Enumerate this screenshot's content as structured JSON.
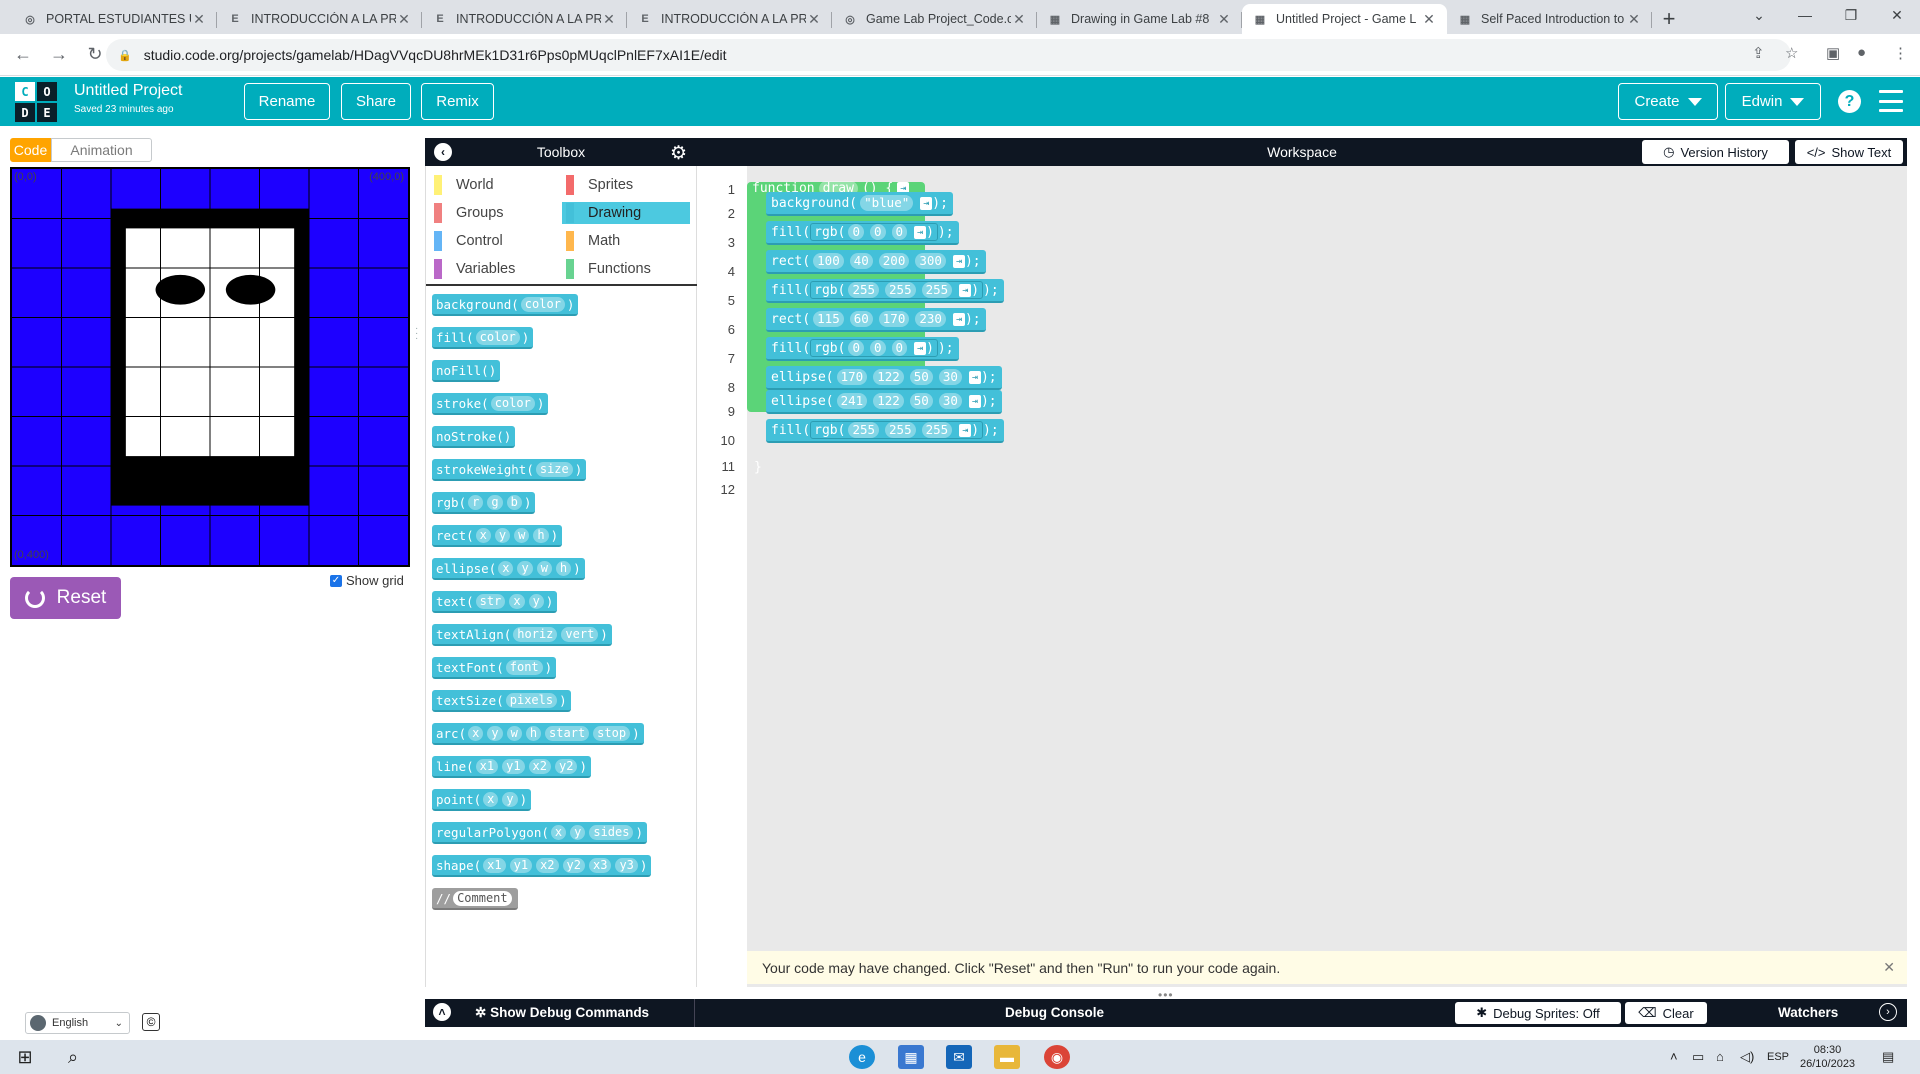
{
  "browser": {
    "tabs": [
      {
        "title": "PORTAL ESTUDIANTES U",
        "icon": "globe-icon"
      },
      {
        "title": "INTRODUCCIÓN A LA PR",
        "icon": "edu-icon"
      },
      {
        "title": "INTRODUCCIÓN A LA PR",
        "icon": "edu-icon"
      },
      {
        "title": "INTRODUCCIÓN A LA PR",
        "icon": "edu-icon"
      },
      {
        "title": "Game Lab Project_Code.o",
        "icon": "globe-icon"
      },
      {
        "title": "Drawing in Game Lab #8",
        "icon": "codeorg-icon"
      },
      {
        "title": "Untitled Project - Game L",
        "icon": "codeorg-icon",
        "active": true
      },
      {
        "title": "Self Paced Introduction to",
        "icon": "codeorg-icon"
      }
    ],
    "url": "studio.code.org/projects/gamelab/HDagVVqcDU8hrMEk1D31r6Pps0pMUqclPnlEF7xAI1E/edit"
  },
  "header": {
    "logo_letters": [
      "C",
      "O",
      "D",
      "E"
    ],
    "project_name": "Untitled Project",
    "saved_text": "Saved 23 minutes ago",
    "rename": "Rename",
    "share": "Share",
    "remix": "Remix",
    "create": "Create",
    "user": "Edwin",
    "help": "?"
  },
  "left": {
    "mode_code": "Code",
    "mode_animation": "Animation",
    "coord_tl": "(0,0)",
    "coord_tr": "(400,0)",
    "coord_bl": "(0,400)",
    "reset": "Reset",
    "show_grid": "Show grid",
    "language": "English",
    "copyright": "©"
  },
  "toolbox": {
    "title": "Toolbox",
    "categories": [
      {
        "label": "World",
        "color": "#fff176"
      },
      {
        "label": "Sprites",
        "color": "#f36b6b"
      },
      {
        "label": "Groups",
        "color": "#f08080"
      },
      {
        "label": "Drawing",
        "color": "#43c0d9",
        "selected": true
      },
      {
        "label": "Control",
        "color": "#64b5f6"
      },
      {
        "label": "Math",
        "color": "#ffb74d"
      },
      {
        "label": "Variables",
        "color": "#ba68c8"
      },
      {
        "label": "Functions",
        "color": "#68d391"
      }
    ],
    "blocks": [
      {
        "name": "background",
        "args": [
          "color"
        ]
      },
      {
        "name": "fill",
        "args": [
          "color"
        ]
      },
      {
        "name": "noFill",
        "args": []
      },
      {
        "name": "stroke",
        "args": [
          "color"
        ]
      },
      {
        "name": "noStroke",
        "args": []
      },
      {
        "name": "strokeWeight",
        "args": [
          "size"
        ]
      },
      {
        "name": "rgb",
        "args": [
          "r",
          "g",
          "b"
        ]
      },
      {
        "name": "rect",
        "args": [
          "x",
          "y",
          "w",
          "h"
        ]
      },
      {
        "name": "ellipse",
        "args": [
          "x",
          "y",
          "w",
          "h"
        ]
      },
      {
        "name": "text",
        "args": [
          "str",
          "x",
          "y"
        ]
      },
      {
        "name": "textAlign",
        "args": [
          "horiz",
          "vert"
        ]
      },
      {
        "name": "textFont",
        "args": [
          "font"
        ]
      },
      {
        "name": "textSize",
        "args": [
          "pixels"
        ]
      },
      {
        "name": "arc",
        "args": [
          "x",
          "y",
          "w",
          "h",
          "start",
          "stop"
        ]
      },
      {
        "name": "line",
        "args": [
          "x1",
          "y1",
          "x2",
          "y2"
        ]
      },
      {
        "name": "point",
        "args": [
          "x",
          "y"
        ]
      },
      {
        "name": "regularPolygon",
        "args": [
          "x",
          "y",
          "sides"
        ]
      },
      {
        "name": "shape",
        "args": [
          "x1",
          "y1",
          "x2",
          "y2",
          "x3",
          "y3"
        ]
      },
      {
        "name": "//",
        "args": [
          "Comment"
        ],
        "grey": true
      }
    ]
  },
  "workspace": {
    "title": "Workspace",
    "version_history": "Version History",
    "show_text": "Show Text",
    "line_numbers": [
      "1",
      "2",
      "3",
      "4",
      "5",
      "6",
      "7",
      "8",
      "9",
      "10",
      "11",
      "12"
    ],
    "function_header": {
      "keyword": "function",
      "name": "draw",
      "suffix": "() {"
    },
    "code_lines": [
      {
        "fn": "background",
        "args": [
          "\"blue\""
        ],
        "nested": false
      },
      {
        "fn": "fill",
        "nested": true,
        "inner": "rgb",
        "args": [
          "0",
          "0",
          "0"
        ]
      },
      {
        "fn": "rect",
        "args": [
          "100",
          "40",
          "200",
          "300"
        ],
        "nested": false
      },
      {
        "fn": "fill",
        "nested": true,
        "inner": "rgb",
        "args": [
          "255",
          "255",
          "255"
        ]
      },
      {
        "fn": "rect",
        "args": [
          "115",
          "60",
          "170",
          "230"
        ],
        "nested": false
      },
      {
        "fn": "fill",
        "nested": true,
        "inner": "rgb",
        "args": [
          "0",
          "0",
          "0"
        ]
      },
      {
        "fn": "ellipse",
        "args": [
          "170",
          "122",
          "50",
          "30"
        ],
        "nested": false
      },
      {
        "fn": "ellipse",
        "args": [
          "241",
          "122",
          "50",
          "30"
        ],
        "nested": false
      },
      {
        "fn": "fill",
        "nested": true,
        "inner": "rgb",
        "args": [
          "255",
          "255",
          "255"
        ]
      }
    ],
    "closing_brace": "}",
    "notice": "Your code may have changed. Click \"Reset\" and then \"Run\" to run your code again."
  },
  "debug": {
    "show_commands": "Show Debug Commands",
    "console": "Debug Console",
    "debug_sprites": "Debug Sprites: Off",
    "clear": "Clear",
    "watchers": "Watchers"
  },
  "taskbar": {
    "time": "08:30",
    "date": "26/10/2023",
    "lang": "ESP"
  },
  "colors": {
    "accent": "#00adbc",
    "stage_bg": "#1d00ff",
    "block": "#43c0d9",
    "function_block": "#5bd478",
    "reset": "#9b59b6",
    "code_toggle": "#ffa400"
  }
}
